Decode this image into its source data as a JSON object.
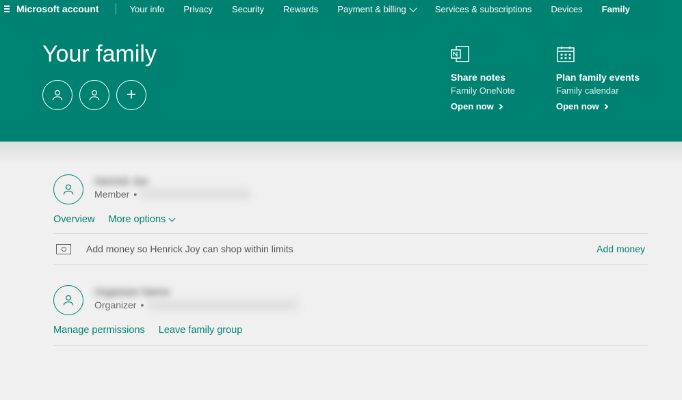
{
  "nav": {
    "brand": "Microsoft account",
    "items": [
      "Your info",
      "Privacy",
      "Security",
      "Rewards",
      "Payment & billing",
      "Services & subscriptions",
      "Devices",
      "Family"
    ],
    "dropdown_index": 4,
    "active_index": 7
  },
  "hero": {
    "title": "Your family",
    "promos": [
      {
        "title": "Share notes",
        "subtitle": "Family OneNote",
        "action": "Open now"
      },
      {
        "title": "Plan family events",
        "subtitle": "Family calendar",
        "action": "Open now"
      }
    ]
  },
  "members": [
    {
      "name": "Henrick Joy",
      "role": "Member",
      "links": [
        {
          "label": "Overview",
          "has_chevron": false
        },
        {
          "label": "More options",
          "has_chevron": true
        }
      ],
      "strip_text": "Add money so Henrick Joy can shop within limits",
      "strip_action": "Add money"
    },
    {
      "name": "Organizer Name",
      "role": "Organizer",
      "links": [
        {
          "label": "Manage permissions",
          "has_chevron": false
        },
        {
          "label": "Leave family group",
          "has_chevron": false
        }
      ]
    }
  ]
}
